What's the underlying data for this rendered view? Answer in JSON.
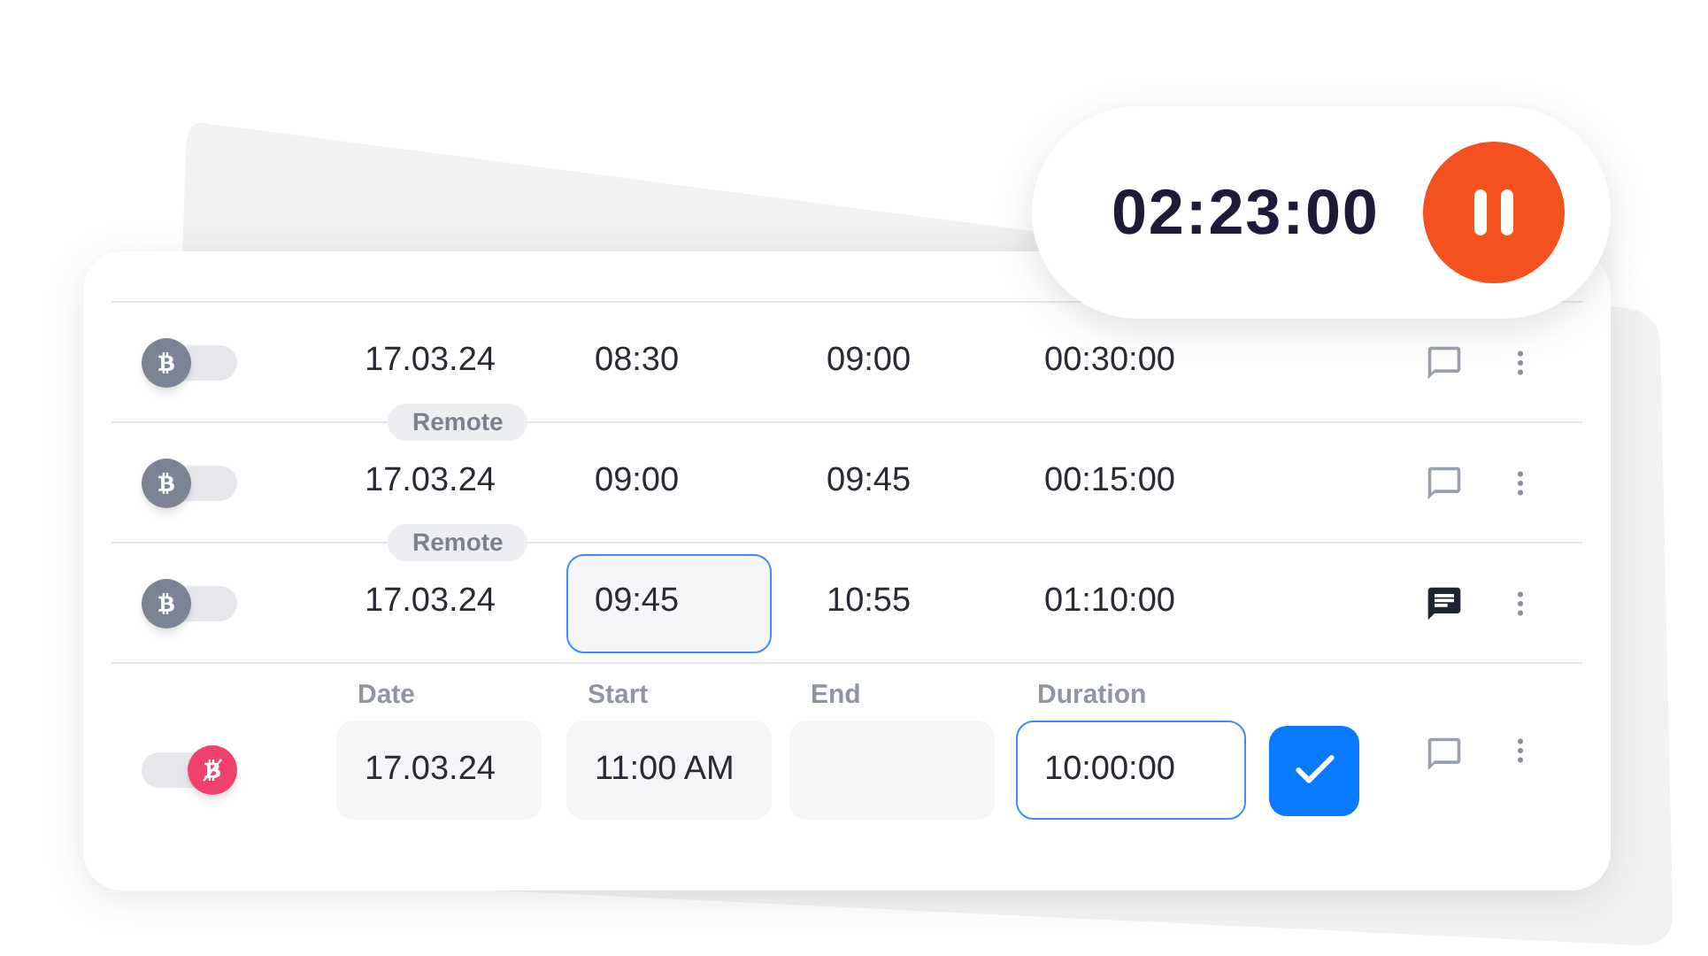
{
  "timer": {
    "time": "02:23:00",
    "running": true
  },
  "rows": [
    {
      "non_billable": false,
      "date": "17.03.24",
      "start": "08:30",
      "end": "09:00",
      "duration": "00:30:00",
      "start_selected": false,
      "has_comment": false
    },
    {
      "non_billable": false,
      "badge": "Remote",
      "date": "17.03.24",
      "start": "09:00",
      "end": "09:45",
      "duration": "00:15:00",
      "start_selected": false,
      "has_comment": false
    },
    {
      "non_billable": false,
      "badge": "Remote",
      "date": "17.03.24",
      "start": "09:45",
      "end": "10:55",
      "duration": "01:10:00",
      "start_selected": true,
      "has_comment": true
    }
  ],
  "edit_row": {
    "non_billable": true,
    "has_comment": false,
    "fields": [
      {
        "label": "Date",
        "value": "17.03.24",
        "selected": false
      },
      {
        "label": "Start",
        "value": "11:00 AM",
        "selected": false
      },
      {
        "label": "End",
        "selected": false
      },
      {
        "label": "Duration",
        "value": "10:00:00",
        "selected": true
      }
    ]
  }
}
